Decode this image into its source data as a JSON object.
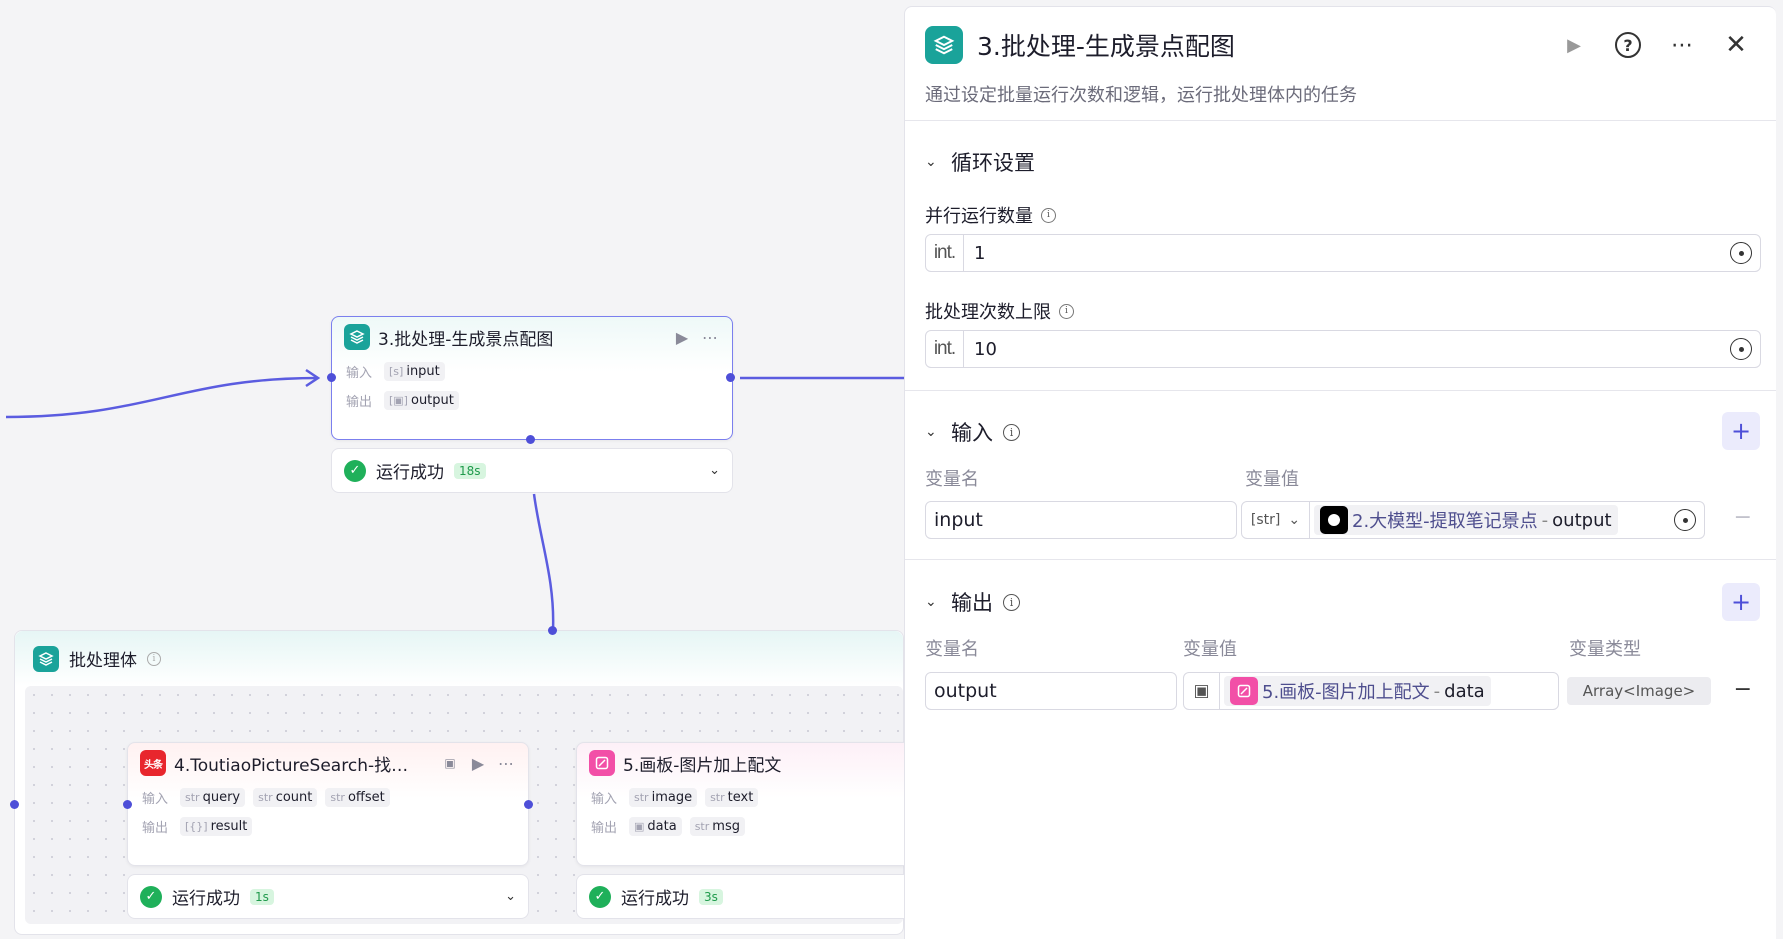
{
  "canvas": {
    "main_node": {
      "title": "3.批处理-生成景点配图",
      "input_label": "输入",
      "input_var": "input",
      "output_label": "输出",
      "output_var": "output",
      "status": "运行成功",
      "duration": "18s"
    },
    "batch_body": {
      "title": "批处理体"
    },
    "node4": {
      "title": "4.ToutiaoPictureSearch-找…",
      "icon_text": "头条",
      "input_label": "输入",
      "output_label": "输出",
      "inputs": [
        {
          "type": "str",
          "name": "query"
        },
        {
          "type": "str",
          "name": "count"
        },
        {
          "type": "str",
          "name": "offset"
        }
      ],
      "output": {
        "type": "[{}]",
        "name": "result"
      },
      "status": "运行成功",
      "duration": "1s"
    },
    "node5": {
      "title": "5.画板-图片加上配文",
      "input_label": "输入",
      "output_label": "输出",
      "inputs": [
        {
          "type": "str",
          "name": "image"
        },
        {
          "type": "str",
          "name": "text"
        }
      ],
      "outputs": [
        {
          "type": "img",
          "name": "data"
        },
        {
          "type": "str",
          "name": "msg"
        }
      ],
      "status": "运行成功",
      "duration": "3s"
    }
  },
  "panel": {
    "title": "3.批处理-生成景点配图",
    "description": "通过设定批量运行次数和逻辑，运行批处理体内的任务",
    "loop_section": {
      "title": "循环设置",
      "parallel_label": "并行运行数量",
      "parallel_type": "int.",
      "parallel_value": "1",
      "limit_label": "批处理次数上限",
      "limit_type": "int.",
      "limit_value": "10"
    },
    "input_section": {
      "title": "输入",
      "col_name": "变量名",
      "col_value": "变量值",
      "var_name": "input",
      "var_type": "[str]",
      "ref_node": "2.大模型-提取笔记景点",
      "ref_sep": " - ",
      "ref_field": "output"
    },
    "output_section": {
      "title": "输出",
      "col_name": "变量名",
      "col_value": "变量值",
      "col_type": "变量类型",
      "var_name": "output",
      "ref_node": "5.画板-图片加上配文",
      "ref_sep": " - ",
      "ref_field": "data",
      "var_type": "Array<Image>"
    }
  },
  "colors": {
    "accent": "#4e4fd8",
    "teal": "#1aa39a",
    "pink": "#f24fa7",
    "success": "#1fb05a"
  }
}
